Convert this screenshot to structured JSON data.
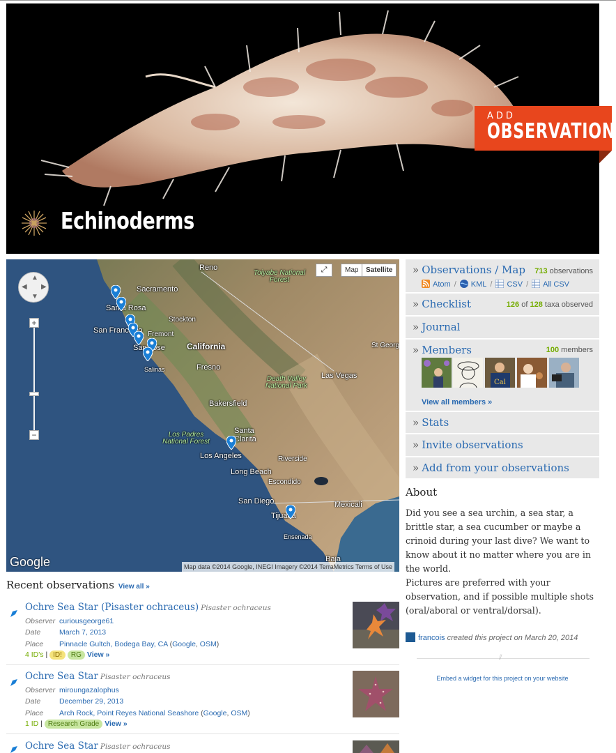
{
  "hero": {
    "title": "Echinoderms",
    "add_small": "ADD",
    "add_big": "OBSERVATIONS"
  },
  "map": {
    "type_map": "Map",
    "type_satellite": "Satellite",
    "zoom_in": "+",
    "zoom_out": "−",
    "google": "Google",
    "attribution": "Map data ©2014 Google, INEGI Imagery ©2014 TerraMetrics    Terms of Use",
    "labels": {
      "reno": "Reno",
      "sacramento": "Sacramento",
      "santa_rosa": "Santa Rosa",
      "stockton": "Stockton",
      "san_francisco": "San Francisco",
      "fremont": "Fremont",
      "san_jose": "San Jose",
      "salinas": "Salinas",
      "california": "California",
      "fresno": "Fresno",
      "st_george": "St George",
      "las_vegas": "Las Vegas",
      "bakersfield": "Bakersfield",
      "santa_clarita": "Santa Clarita",
      "los_angeles": "Los Angeles",
      "riverside": "Riverside",
      "long_beach": "Long Beach",
      "escondido": "Escondido",
      "san_diego": "San Diego",
      "mexicali": "Mexicali",
      "tijuana": "Tijuana",
      "ensenada": "Ensenada",
      "baja": "Baja",
      "toiyabe": "Toiyabe National Forest",
      "death_valley": "Death Valley National Park",
      "los_padres": "Los Padres National Forest"
    }
  },
  "sidebar": {
    "observations": {
      "label": "Observations / Map",
      "count": "713",
      "unit": "observations"
    },
    "exports": {
      "atom": "Atom",
      "kml": "KML",
      "csv": "CSV",
      "all_csv": "All CSV",
      "sep": "/"
    },
    "checklist": {
      "label": "Checklist",
      "count": "126",
      "of": "of",
      "total": "128",
      "unit": "taxa observed"
    },
    "journal": {
      "label": "Journal"
    },
    "members": {
      "label": "Members",
      "count": "100",
      "unit": "members",
      "view_all": "View all members »"
    },
    "stats": {
      "label": "Stats"
    },
    "invite": {
      "label": "Invite observations"
    },
    "add_from": {
      "label": "Add from your observations"
    },
    "chevron": "»"
  },
  "about": {
    "heading": "About",
    "p1": "Did you see a sea urchin, a sea star, a brittle star, a sea cucumber or maybe a crinoid during your last dive? We want to know about it no matter where you are in the world.",
    "p2": "Pictures are preferred with your observation, and if possible multiple shots (oral/aboral or ventral/dorsal).",
    "creator_name": "francois",
    "creator_text": "created this project on March 20, 2014",
    "embed": "Embed a widget for this project on your website"
  },
  "recent": {
    "heading": "Recent observations",
    "view_all": "View all »",
    "labels": {
      "observer": "Observer",
      "date": "Date",
      "place": "Place"
    },
    "items": [
      {
        "title": "Ochre Sea Star (Pisaster ochraceus)",
        "sci": "Pisaster ochraceus",
        "observer": "curiousgeorge61",
        "date": "March 7, 2013",
        "place": "Pinnacle Gultch, Bodega Bay, CA",
        "google": "Google",
        "osm": "OSM",
        "ids": "4 ID's",
        "badge1": "ID!",
        "badge2": "RG",
        "view": "View »"
      },
      {
        "title": "Ochre Sea Star",
        "sci": "Pisaster ochraceus",
        "observer": "miroungazalophus",
        "date": "December 29, 2013",
        "place": "Arch Rock, Point Reyes National Seashore",
        "google": "Google",
        "osm": "OSM",
        "ids": "1 ID",
        "badge1": "Research Grade",
        "view": "View »"
      },
      {
        "title": "Ochre Sea Star",
        "sci": "Pisaster ochraceus"
      }
    ]
  }
}
